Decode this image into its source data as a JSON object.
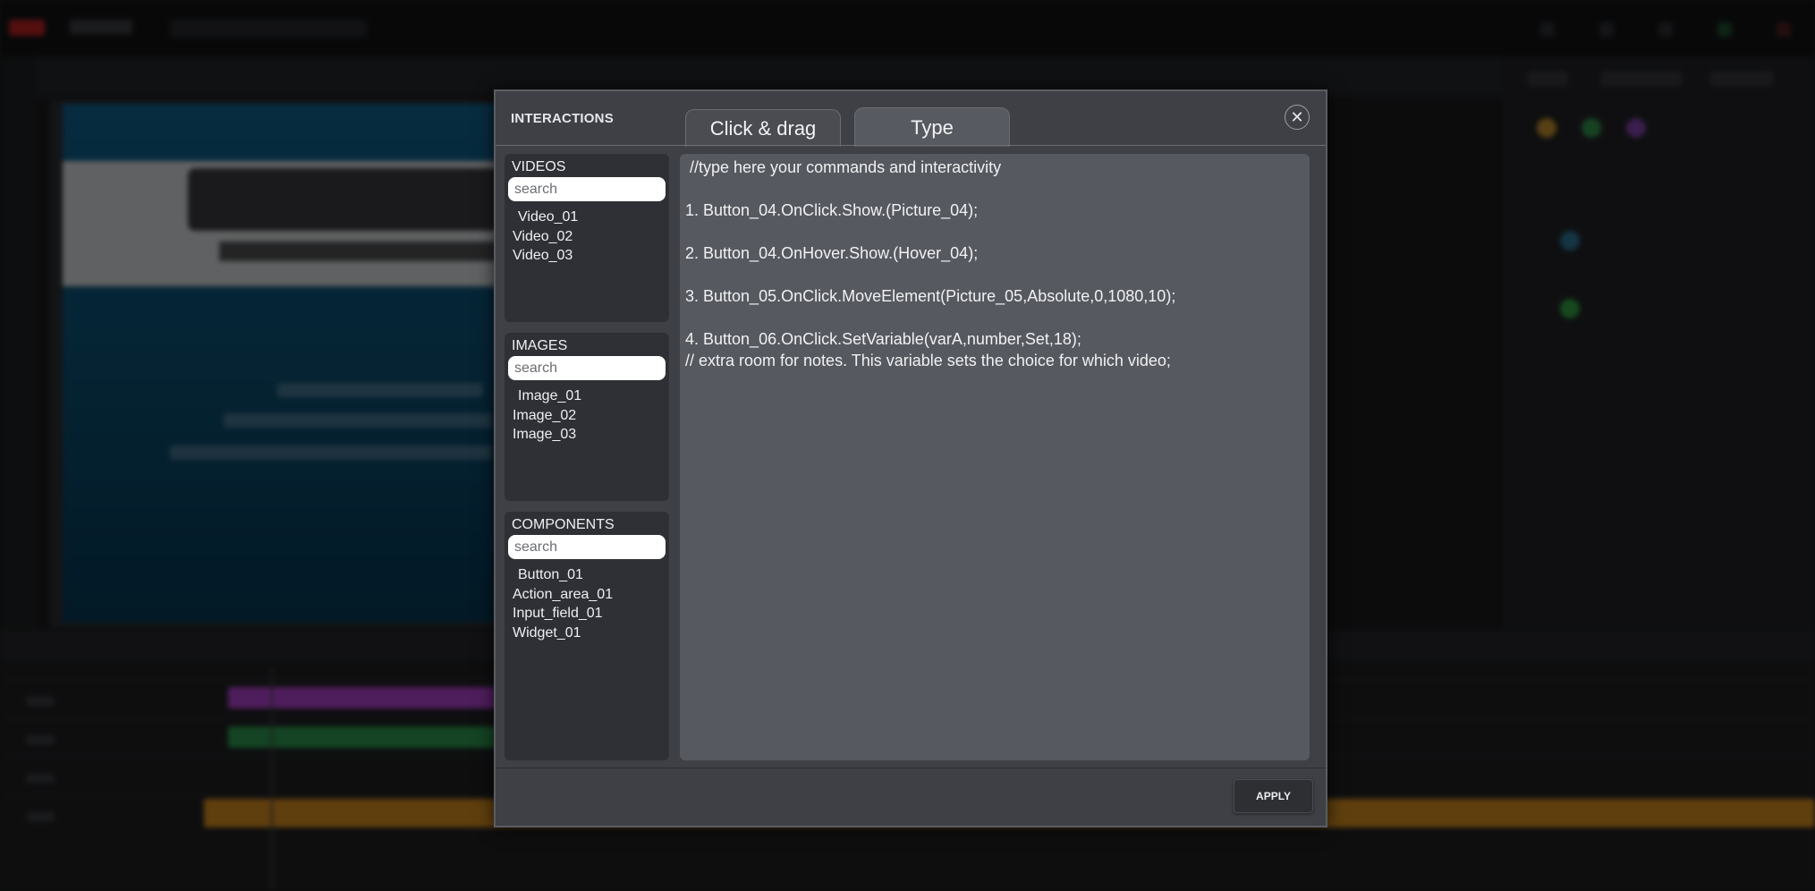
{
  "modal": {
    "title": "INTERACTIONS",
    "tabs": [
      {
        "label": "Click & drag",
        "active": false
      },
      {
        "label": "Type",
        "active": true
      }
    ],
    "close_icon": "close-icon",
    "apply_label": "APPLY"
  },
  "panels": {
    "videos": {
      "title": "VIDEOS",
      "search_placeholder": "search",
      "items": [
        "Video_01",
        "Video_02",
        "Video_03"
      ]
    },
    "images": {
      "title": "IMAGES",
      "search_placeholder": "search",
      "items": [
        "Image_01",
        "Image_02",
        "Image_03"
      ]
    },
    "components": {
      "title": "COMPONENTS",
      "search_placeholder": "search",
      "items": [
        "Button_01",
        "Action_area_01",
        "Input_field_01",
        "Widget_01"
      ]
    }
  },
  "editor": {
    "lines": [
      " //type here your commands and interactivity",
      "1. Button_04.OnClick.Show.(Picture_04);",
      "2. Button_04.OnHover.Show.(Hover_04);",
      "3. Button_05.OnClick.MoveElement(Picture_05,Absolute,0,1080,10);",
      "4. Button_06.OnClick.SetVariable(varA,number,Set,18);",
      "// extra room for notes. This variable sets the choice for which video;"
    ]
  },
  "colors": {
    "modal_bg": "#3e4046",
    "panel_bg": "#2e3035",
    "editor_bg": "#575960",
    "clip_purple": "#a43fc0",
    "clip_green": "#2a8f4a",
    "clip_orange": "#c7841f"
  }
}
